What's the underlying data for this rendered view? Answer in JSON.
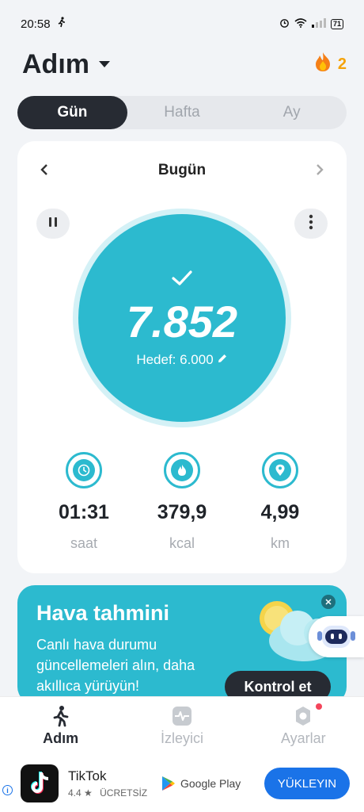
{
  "status_bar": {
    "time": "20:58",
    "battery": "71"
  },
  "header": {
    "title": "Adım",
    "streak_count": "2"
  },
  "segments": [
    {
      "label": "Gün",
      "active": true
    },
    {
      "label": "Hafta",
      "active": false
    },
    {
      "label": "Ay",
      "active": false
    }
  ],
  "day": {
    "label": "Bugün",
    "steps": "7.852",
    "goal": "Hedef: 6.000",
    "progress_fraction": 1.0
  },
  "stats": [
    {
      "icon": "clock-icon",
      "value": "01:31",
      "unit": "saat"
    },
    {
      "icon": "flame-icon",
      "value": "379,9",
      "unit": "kcal"
    },
    {
      "icon": "location-pin-icon",
      "value": "4,99",
      "unit": "km"
    }
  ],
  "promo": {
    "title": "Hava tahmini",
    "text": "Canlı hava durumu güncellemeleri alın, daha akıllıca yürüyün!",
    "cta": "Kontrol et"
  },
  "bottom_nav": [
    {
      "label": "Adım",
      "active": true
    },
    {
      "label": "İzleyici",
      "active": false
    },
    {
      "label": "Ayarlar",
      "active": false
    }
  ],
  "ad": {
    "app_name": "TikTok",
    "rating": "4.4 ★",
    "price": "ÜCRETSİZ",
    "store": "Google Play",
    "install": "YÜKLEYIN"
  },
  "colors": {
    "accent": "#2cbacf",
    "dark": "#272b33",
    "streak": "#f5a30a",
    "install": "#1a73e8"
  }
}
